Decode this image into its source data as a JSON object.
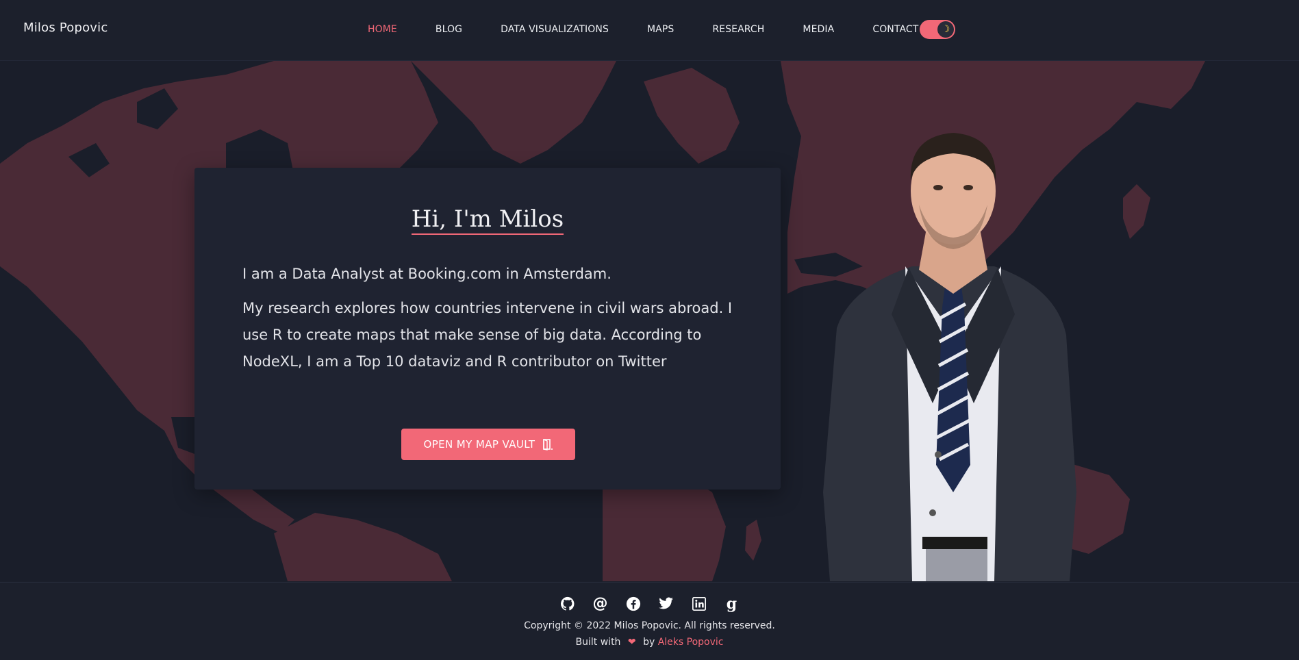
{
  "header": {
    "brand": "Milos Popovic",
    "nav": [
      {
        "label": "HOME",
        "active": true
      },
      {
        "label": "BLOG"
      },
      {
        "label": "DATA VISUALIZATIONS"
      },
      {
        "label": "MAPS"
      },
      {
        "label": "RESEARCH"
      },
      {
        "label": "MEDIA"
      },
      {
        "label": "CONTACT"
      }
    ],
    "theme_toggle_icon": "moon-icon"
  },
  "intro": {
    "title": "Hi, I'm Milos",
    "line1": "I am a Data Analyst at Booking.com in Amsterdam.",
    "line2": "My research explores how countries intervene in civil wars abroad. I use R to create maps that make sense of big data. According to NodeXL, I am a Top 10 dataviz and R contributor on Twitter",
    "cta_label": "OPEN MY MAP VAULT",
    "cta_icon": "door-icon"
  },
  "footer": {
    "social": [
      "github-icon",
      "email-icon",
      "facebook-icon",
      "twitter-icon",
      "linkedin-icon",
      "google-scholar-icon"
    ],
    "copyright": "Copyright © 2022 Milos Popovic. All rights reserved.",
    "built_prefix": "Built with",
    "built_by": "by",
    "author": "Aleks Popovic"
  },
  "colors": {
    "accent": "#f26877",
    "background": "#1a1e2a",
    "land": "#4a2a36"
  }
}
